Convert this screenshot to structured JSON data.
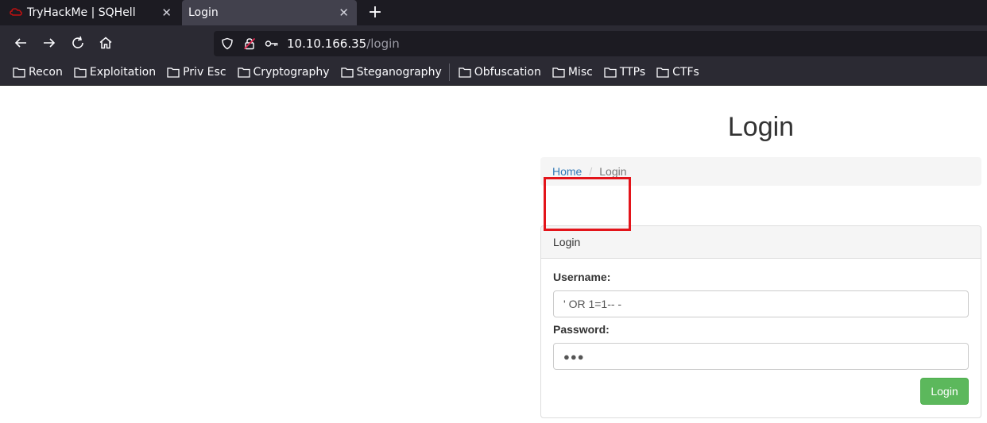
{
  "browser": {
    "tabs": [
      {
        "title": "TryHackMe | SQHell",
        "active": false
      },
      {
        "title": "Login",
        "active": true
      }
    ],
    "url_host": "10.10.166.35",
    "url_path": "/login",
    "bookmarks": [
      "Recon",
      "Exploitation",
      "Priv Esc",
      "Cryptography",
      "Steganography",
      "Obfuscation",
      "Misc",
      "TTPs",
      "CTFs"
    ]
  },
  "page": {
    "title": "Login",
    "breadcrumb": {
      "home": "Home",
      "separator": "/",
      "current": "Login"
    },
    "panel": {
      "heading": "Login",
      "username_label": "Username:",
      "username_value": "' OR 1=1-- -",
      "password_label": "Password:",
      "password_value": "●●●",
      "submit_label": "Login"
    }
  },
  "colors": {
    "highlight": "#e3141a",
    "button": "#5cb85c",
    "link": "#337ab7"
  }
}
